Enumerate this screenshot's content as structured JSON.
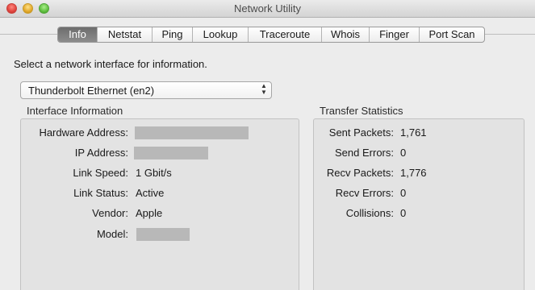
{
  "window": {
    "title": "Network Utility"
  },
  "tabs": [
    {
      "label": "Info",
      "active": true
    },
    {
      "label": "Netstat",
      "active": false
    },
    {
      "label": "Ping",
      "active": false
    },
    {
      "label": "Lookup",
      "active": false
    },
    {
      "label": "Traceroute",
      "active": false
    },
    {
      "label": "Whois",
      "active": false
    },
    {
      "label": "Finger",
      "active": false
    },
    {
      "label": "Port Scan",
      "active": false
    }
  ],
  "info": {
    "instruction": "Select a network interface for information.",
    "interface_selected": "Thunderbolt Ethernet (en2)"
  },
  "interface_information": {
    "title": "Interface Information",
    "hardware_address_label": "Hardware Address:",
    "ip_address_label": "IP Address:",
    "link_speed_label": "Link Speed:",
    "link_speed_value": "1 Gbit/s",
    "link_status_label": "Link Status:",
    "link_status_value": "Active",
    "vendor_label": "Vendor:",
    "vendor_value": "Apple",
    "model_label": "Model:"
  },
  "transfer_statistics": {
    "title": "Transfer Statistics",
    "sent_packets_label": "Sent Packets:",
    "sent_packets_value": "1,761",
    "send_errors_label": "Send Errors:",
    "send_errors_value": "0",
    "recv_packets_label": "Recv Packets:",
    "recv_packets_value": "1,776",
    "recv_errors_label": "Recv Errors:",
    "recv_errors_value": "0",
    "collisions_label": "Collisions:",
    "collisions_value": "0"
  },
  "colors": {
    "window_bg": "#ececec",
    "group_bg": "#e3e3e3",
    "active_tab": "#7a7a7a",
    "redaction": "#b8b8b8"
  }
}
